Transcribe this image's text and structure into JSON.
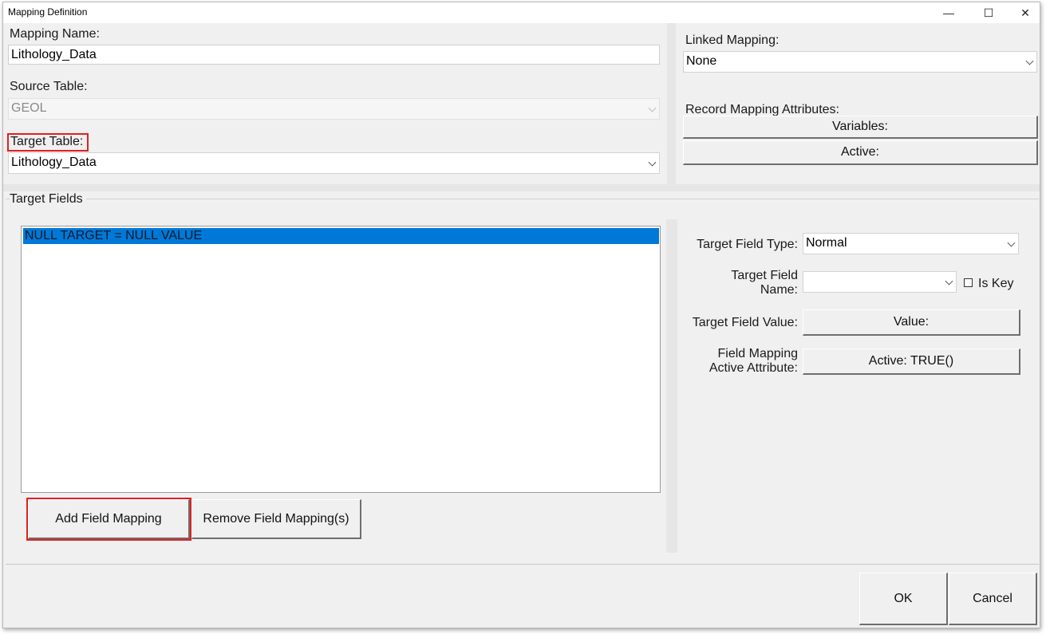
{
  "window": {
    "title": "Mapping Definition",
    "controls": {
      "minimize": "—",
      "maximize": "☐",
      "close": "✕"
    }
  },
  "mapping_name": {
    "label": "Mapping Name:",
    "value": "Lithology_Data"
  },
  "source_table": {
    "label": "Source Table:",
    "value": "GEOL"
  },
  "target_table": {
    "label": "Target Table:",
    "value": "Lithology_Data"
  },
  "linked_mapping": {
    "label": "Linked Mapping:",
    "value": "None"
  },
  "record_attributes": {
    "label": "Record Mapping Attributes:",
    "variables_button": "Variables:",
    "active_button": "Active:"
  },
  "target_fields": {
    "group_label": "Target Fields",
    "items": [
      "NULL TARGET = NULL VALUE"
    ],
    "add_button": "Add Field Mapping",
    "remove_button": "Remove Field Mapping(s)"
  },
  "field_details": {
    "type_label": "Target Field Type:",
    "type_value": "Normal",
    "name_label_line1": "Target Field",
    "name_label_line2": "Name:",
    "name_value": "",
    "is_key_label": "Is Key",
    "value_label": "Target Field Value:",
    "value_button": "Value:",
    "active_label_line1": "Field Mapping",
    "active_label_line2": "Active Attribute:",
    "active_button": "Active: TRUE()"
  },
  "footer": {
    "ok": "OK",
    "cancel": "Cancel"
  },
  "colors": {
    "highlight": "#e02020",
    "selection": "#0078d7"
  }
}
